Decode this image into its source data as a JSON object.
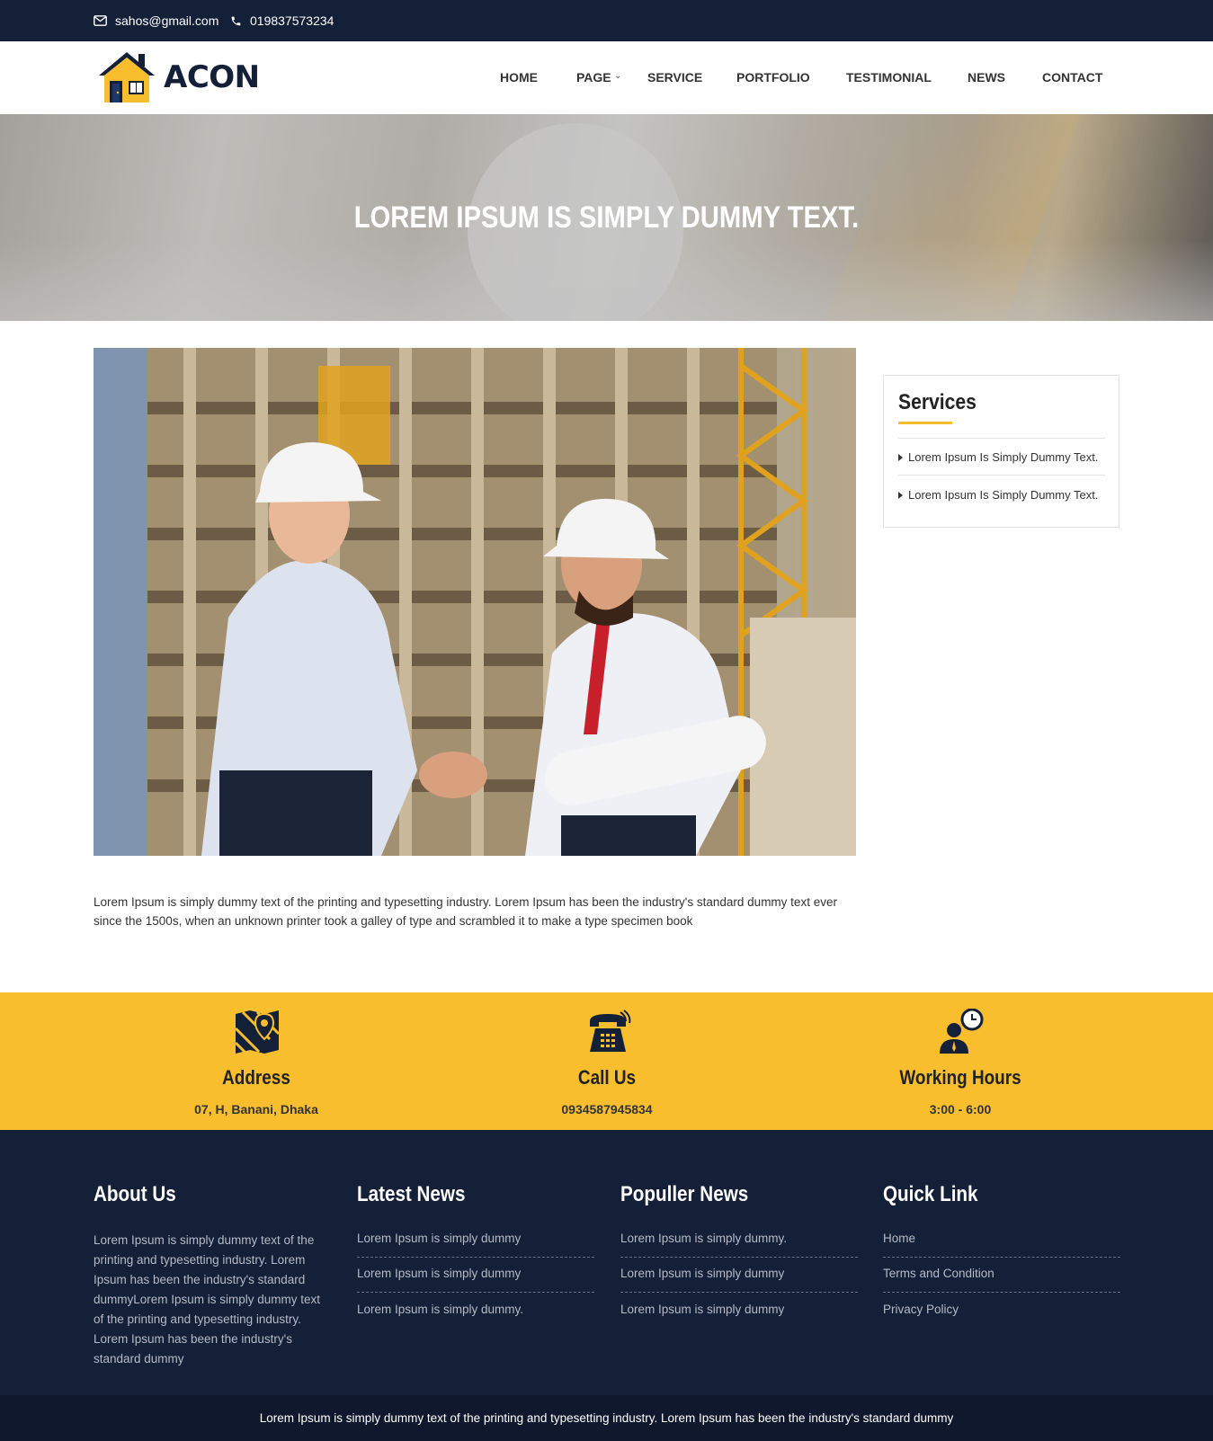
{
  "topbar": {
    "email": "sahos@gmail.com",
    "phone": "019837573234"
  },
  "brand": {
    "name": "ACON",
    "colors": {
      "navy": "#141f38",
      "accent": "#f8be2e"
    }
  },
  "nav": {
    "items": [
      {
        "label": "HOME"
      },
      {
        "label": "PAGE"
      },
      {
        "label": "SERVICE"
      },
      {
        "label": "PORTFOLIO"
      },
      {
        "label": "TESTIMONIAL"
      },
      {
        "label": "NEWS"
      },
      {
        "label": "CONTACT"
      }
    ]
  },
  "banner": {
    "title": "LOREM IPSUM IS SIMPLY DUMMY TEXT."
  },
  "main": {
    "image_icon": "handshake-photo",
    "paragraph": "Lorem Ipsum is simply dummy text of the printing and typesetting industry. Lorem Ipsum has been the industry's standard dummy text ever since the 1500s, when an unknown printer took a galley of type and scrambled it to make a type specimen book"
  },
  "sidebar": {
    "title": "Services",
    "items": [
      "Lorem Ipsum Is Simply Dummy Text.",
      "Lorem Ipsum Is Simply Dummy Text."
    ]
  },
  "info": {
    "address": {
      "icon": "map-icon",
      "title": "Address",
      "value": "07, H, Banani, Dhaka"
    },
    "call": {
      "icon": "phone-icon",
      "title": "Call Us",
      "value": "0934587945834"
    },
    "hours": {
      "icon": "clock-person-icon",
      "title": "Working Hours",
      "value": "3:00 - 6:00"
    }
  },
  "footer": {
    "about": {
      "title": "About Us",
      "text": "Lorem Ipsum is simply dummy text of the printing and typesetting industry. Lorem Ipsum has been the industry's standard dummyLorem Ipsum is simply dummy text of the printing and typesetting industry. Lorem Ipsum has been the industry's standard dummy"
    },
    "latest": {
      "title": "Latest News",
      "links": [
        "Lorem Ipsum is simply dummy",
        "Lorem Ipsum is simply dummy",
        "Lorem Ipsum is simply dummy."
      ]
    },
    "popular": {
      "title": "Populler News",
      "links": [
        "Lorem Ipsum is simply dummy.",
        "Lorem Ipsum is simply dummy",
        "Lorem Ipsum is simply dummy"
      ]
    },
    "quick": {
      "title": "Quick Link",
      "links": [
        "Home",
        "Terms and Condition",
        "Privacy Policy"
      ]
    }
  },
  "copyright": "Lorem Ipsum is simply dummy text of the printing and typesetting industry. Lorem Ipsum has been the industry's standard dummy"
}
